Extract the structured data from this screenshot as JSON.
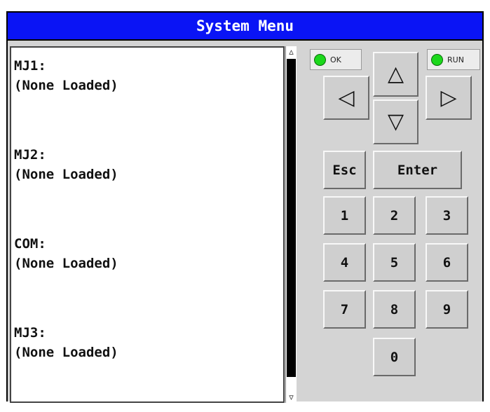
{
  "window": {
    "title": "System Menu"
  },
  "display": {
    "entries": [
      {
        "name": "MJ1:",
        "status": "(None Loaded)"
      },
      {
        "name": "MJ2:",
        "status": "(None Loaded)"
      },
      {
        "name": "COM:",
        "status": "(None Loaded)"
      },
      {
        "name": "MJ3:",
        "status": "(None Loaded)"
      }
    ]
  },
  "scrollbar": {
    "up_icon": "▵",
    "down_icon": "▿"
  },
  "indicators": {
    "ok": {
      "label": "OK",
      "color": "#1cd81c"
    },
    "run": {
      "label": "RUN",
      "color": "#1cd81c"
    }
  },
  "keypad": {
    "up": "△",
    "down": "▽",
    "left": "◁",
    "right": "▷",
    "esc": "Esc",
    "enter": "Enter",
    "digits": [
      "1",
      "2",
      "3",
      "4",
      "5",
      "6",
      "7",
      "8",
      "9",
      "0"
    ]
  },
  "colors": {
    "titlebar": "#0a14f5",
    "panel": "#d4d4d4"
  }
}
